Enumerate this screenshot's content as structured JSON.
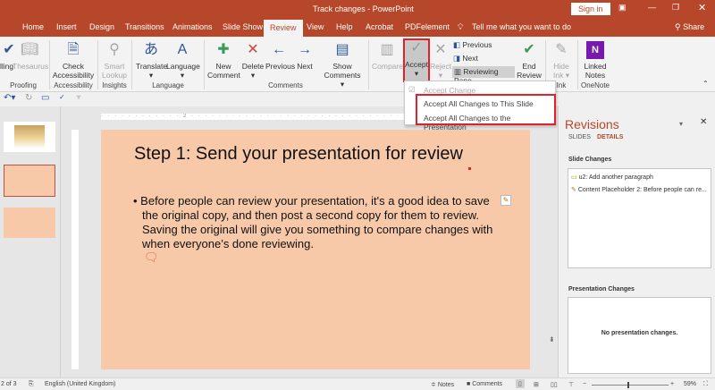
{
  "window": {
    "title": "Track changes  -  PowerPoint",
    "sign_in": "Sign in"
  },
  "tabs": [
    {
      "label": "Home"
    },
    {
      "label": "Insert"
    },
    {
      "label": "Design"
    },
    {
      "label": "Transitions"
    },
    {
      "label": "Animations"
    },
    {
      "label": "Slide Show"
    },
    {
      "label": "Review",
      "active": true
    },
    {
      "label": "View"
    },
    {
      "label": "Help"
    },
    {
      "label": "Acrobat"
    },
    {
      "label": "PDFelement"
    }
  ],
  "tell_me": "Tell me what you want to do",
  "share": "Share",
  "ribbon": {
    "spelling": "lling",
    "thesaurus": "Thesaurus",
    "proofing": "Proofing",
    "check_accessibility": "Check Accessibility",
    "accessibility": "Accessibility",
    "smart_lookup": "Smart Lookup",
    "insights": "Insights",
    "translate": "Translate",
    "language_btn": "Language",
    "language": "Language",
    "new_comment": "New Comment",
    "delete": "Delete",
    "previous": "Previous",
    "next": "Next",
    "show_comments": "Show Comments",
    "comments": "Comments",
    "compare": "Compare",
    "accept": "Accept",
    "reject": "Reject",
    "prev_change": "Previous",
    "next_change": "Next",
    "reviewing_pane": "Reviewing Pane",
    "end_review": "End Review",
    "hide_ink": "Hide Ink",
    "ink": "Ink",
    "linked_notes": "Linked Notes",
    "onenote": "OneNote"
  },
  "accept_menu": {
    "items": [
      {
        "label": "Accept Change",
        "disabled": true
      },
      {
        "label": "Accept All Changes to This Slide"
      },
      {
        "label": "Accept All Changes to the Presentation"
      }
    ]
  },
  "ruler_mark": "2",
  "slide": {
    "title": "Step 1: Send your presentation for review",
    "body": "Before people can review your presentation, it's a good idea to save the original copy, and then post a second copy for them to review. Saving the original will give you something to compare changes with when everyone’s done reviewing.",
    "background": "#f8c9a9"
  },
  "revisions": {
    "title": "Revisions",
    "tabs": [
      "SLIDES",
      "DETAILS"
    ],
    "active_tab": "DETAILS",
    "slide_changes_label": "Slide Changes",
    "slide_changes": [
      "u2: Add another paragraph",
      "Content Placeholder 2: Before people can re..."
    ],
    "presentation_changes_label": "Presentation Changes",
    "presentation_changes_empty": "No presentation changes."
  },
  "status": {
    "slide": "2 of 3",
    "language": "English (United Kingdom)",
    "notes": "Notes",
    "comments": "Comments",
    "zoom": "59%"
  },
  "colors": {
    "accent": "#b7472a",
    "highlight": "#e0202a"
  }
}
